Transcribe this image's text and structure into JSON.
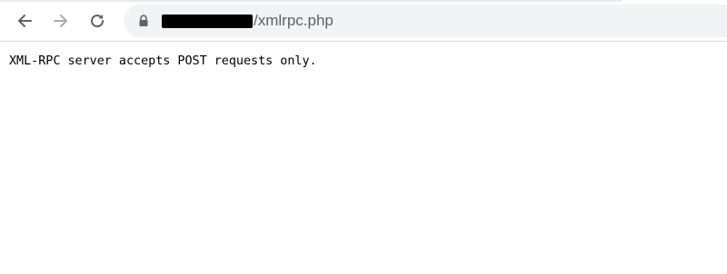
{
  "toolbar": {
    "back_icon": "arrow-left-icon",
    "forward_icon": "arrow-right-icon",
    "reload_icon": "reload-icon",
    "lock_icon": "lock-icon",
    "address": {
      "path": "/xmlrpc.php"
    }
  },
  "page": {
    "message": "XML-RPC server accepts POST requests only."
  },
  "colors": {
    "toolbar_border": "#dadce0",
    "omnibox_bg": "#f1f3f4",
    "url_text": "#5f6368",
    "page_text": "#000000"
  }
}
